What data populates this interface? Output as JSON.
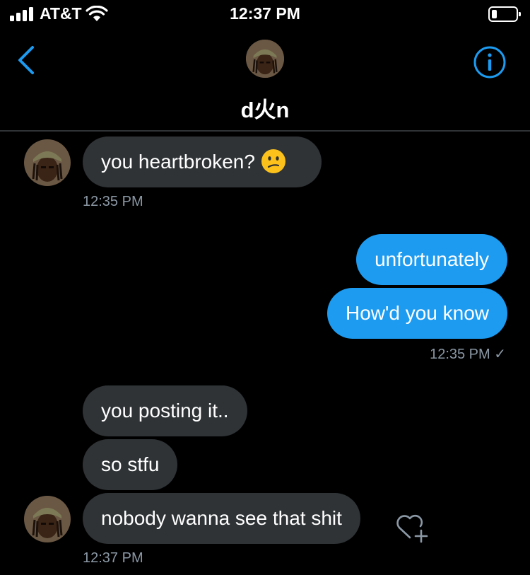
{
  "status": {
    "carrier": "AT&T",
    "time": "12:37 PM"
  },
  "header": {
    "name": "d火n"
  },
  "messages": [
    {
      "from": "them",
      "text": "you heartbroken?",
      "emoji": "confused-face"
    },
    {
      "from": "them",
      "timestamp": "12:35 PM"
    },
    {
      "from": "me",
      "text": "unfortunately"
    },
    {
      "from": "me",
      "text": "How'd you know"
    },
    {
      "from": "me",
      "timestamp": "12:35 PM ✓"
    },
    {
      "from": "them",
      "text": "you posting it.."
    },
    {
      "from": "them",
      "text": "so stfu"
    },
    {
      "from": "them",
      "text": "nobody wanna see that shit"
    },
    {
      "from": "them",
      "timestamp": "12:37 PM"
    }
  ],
  "colors": {
    "accent": "#1d9bf0",
    "incoming_bubble": "#2f3336",
    "timestamp": "#8b98a5",
    "background": "#000000"
  },
  "icons": [
    "signal-icon",
    "wifi-icon",
    "battery-icon",
    "back-chevron-icon",
    "info-icon",
    "confused-face-emoji",
    "heart-plus-icon"
  ]
}
